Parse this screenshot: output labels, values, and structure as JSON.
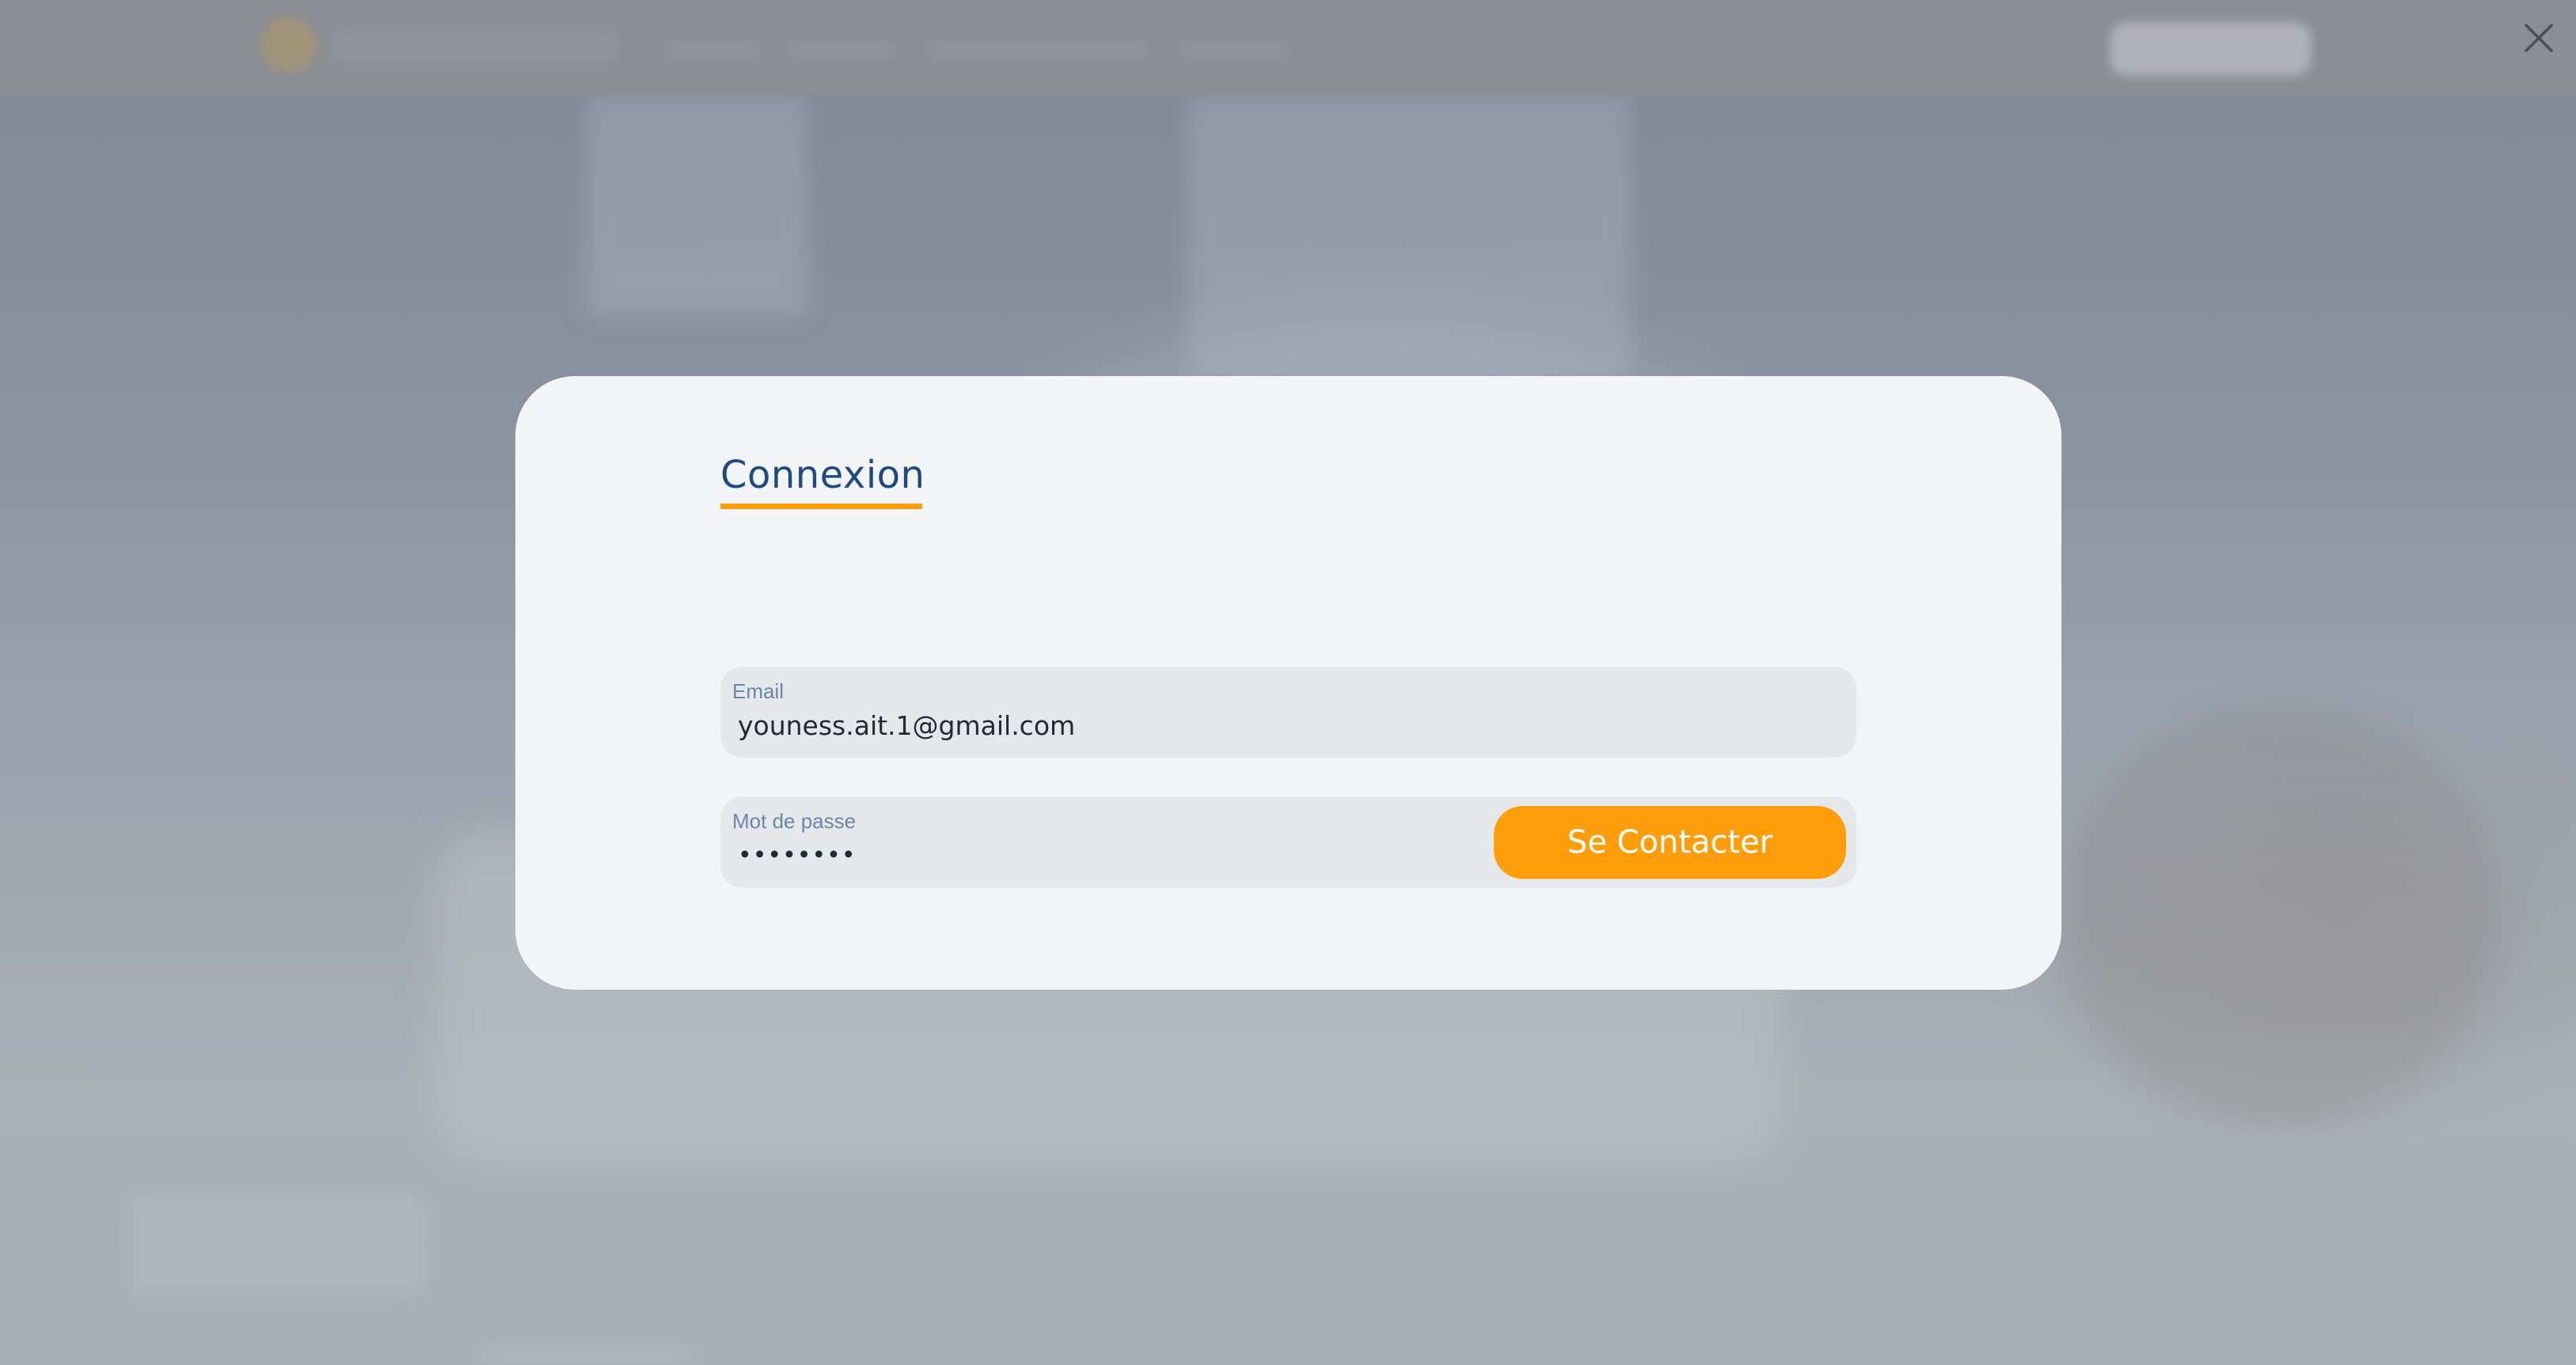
{
  "modal": {
    "title": "Connexion",
    "accent_color": "#ff9d0a",
    "title_color": "#1d4a85",
    "close_icon": "close-icon"
  },
  "form": {
    "email": {
      "label": "Email",
      "value": "youness.ait.1@gmail.com"
    },
    "password": {
      "label": "Mot de passe",
      "value": "password"
    },
    "submit_label": "Se Contacter"
  }
}
